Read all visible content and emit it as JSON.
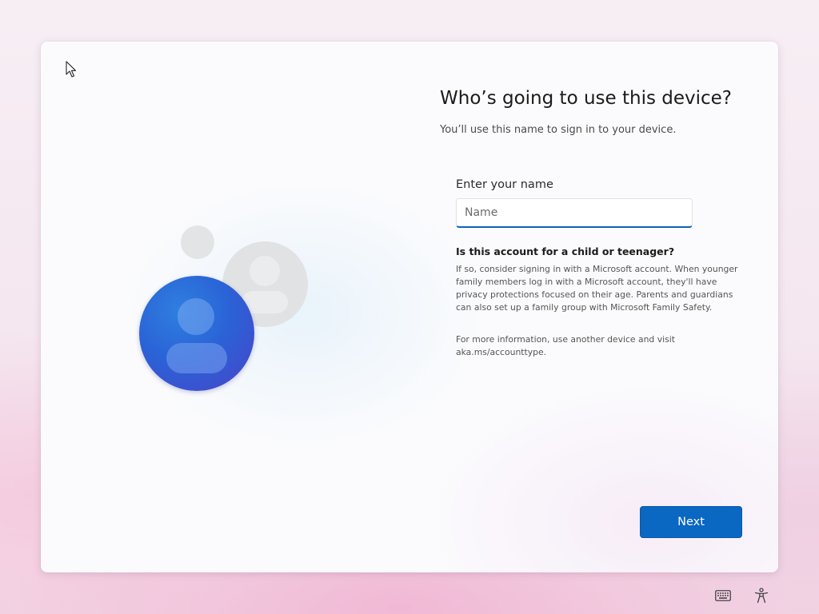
{
  "dialog": {
    "title": "Who’s going to use this device?",
    "subtitle": "You’ll use this name to sign in to your device.",
    "name_field": {
      "label": "Enter your name",
      "placeholder": "Name",
      "value": ""
    },
    "child_section": {
      "heading": "Is this account for a child or teenager?",
      "body": "If so, consider signing in with a Microsoft account. When younger family members log in with a Microsoft account, they'll have privacy protections focused on their age. Parents and guardians can also set up a family group with Microsoft Family Safety.",
      "more_info": "For more information, use another device and visit aka.ms/accounttype."
    },
    "next_label": "Next"
  },
  "taskbar": {
    "icons": [
      "keyboard-icon",
      "accessibility-icon"
    ]
  },
  "colors": {
    "accent": "#0a67c2",
    "avatar_blue": "#2a63d6",
    "avatar_grey": "#e1e2e4"
  }
}
